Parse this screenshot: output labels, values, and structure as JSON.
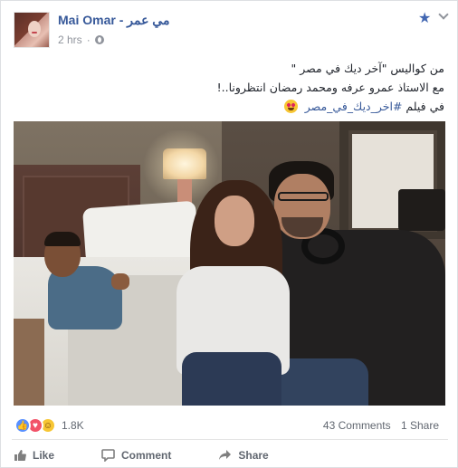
{
  "post": {
    "author": "Mai Omar - مي عمر",
    "time": "2 hrs",
    "separator": "·",
    "text_lines": [
      "من كواليس \"آخر ديك في مصر \"",
      "مع الاستاذ عمرو عرفه ومحمد رمضان انتظرونا..!"
    ],
    "text_prefix": "في فيلم ",
    "hashtag": "#اخر_ديك_في_مصر"
  },
  "icons": {
    "star": "star-icon",
    "privacy": "globe-icon",
    "menu": "chevron-down-icon",
    "emoji": "heart-eyes-emoji-icon"
  },
  "reactions": {
    "types": [
      "like",
      "love",
      "haha"
    ],
    "count": "1.8K"
  },
  "stats": {
    "comments": "43 Comments",
    "shares": "1 Share"
  },
  "actions": {
    "like": "Like",
    "comment": "Comment",
    "share": "Share"
  },
  "colors": {
    "link": "#365899",
    "accent": "#4267b2",
    "muted": "#90949c",
    "like": "#5890ff",
    "love": "#f25268",
    "haha": "#f7c634"
  }
}
